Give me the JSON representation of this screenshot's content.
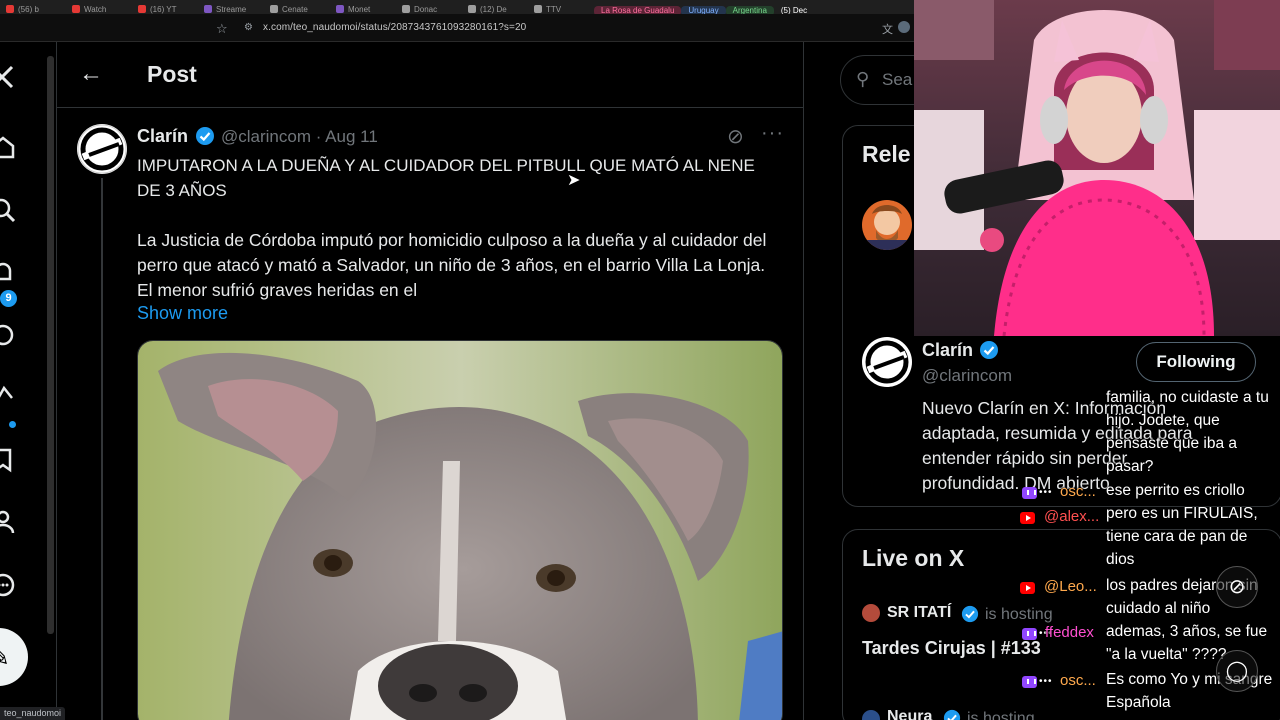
{
  "browser": {
    "tabs": [
      {
        "label": "(56) b",
        "color": "#e53935"
      },
      {
        "label": "Watch",
        "color": "#e53935"
      },
      {
        "label": "(16) YT",
        "color": "#e53935"
      },
      {
        "label": "Streame",
        "color": "#7e57c2"
      },
      {
        "label": "Cenate",
        "color": "#9e9e9e"
      },
      {
        "label": "Monet",
        "color": "#7e57c2"
      },
      {
        "label": "Donac",
        "color": "#9e9e9e"
      },
      {
        "label": "(12) De",
        "color": "#9e9e9e"
      },
      {
        "label": "TTV",
        "color": "#9e9e9e"
      }
    ],
    "group_tabs": [
      {
        "label": "La Rosa de Guadalu",
        "style": "pill-pink"
      },
      {
        "label": "Uruguay",
        "style": "pill-blue"
      },
      {
        "label": "Argentina",
        "style": "pill-green"
      },
      {
        "label": "(5) Dec",
        "style": "active"
      }
    ],
    "url": "x.com/teo_naudomoi/status/2087343761093280161?s=20",
    "status_url": "teo_naudomoi"
  },
  "nav": {
    "notification_count": "9"
  },
  "header": {
    "title": "Post"
  },
  "post": {
    "author_name": "Clarín",
    "handle_date": "@clarincom · Aug 11",
    "headline": "IMPUTARON A LA DUEÑA Y AL CUIDADOR DEL PITBULL QUE MATÓ AL NENE DE 3 AÑOS",
    "body": "La Justicia de Córdoba imputó por homicidio culposo a la dueña y al cuidador del perro que atacó y mató a Salvador, un niño de 3 años, en el barrio Villa La Lonja. El menor sufrió graves heridas en el",
    "show_more": "Show more"
  },
  "sidebar": {
    "search_placeholder": "Sea",
    "relevant_title": "Rele",
    "relevant_name": "Clarín",
    "relevant_handle": "@clarincom",
    "following_label": "Following",
    "relevant_bio": "Nuevo Clarín en X: Información adaptada, resumida y editada para entender rápido sin perder profundidad. DM abierto.",
    "live_title": "Live on X",
    "live_host": "SR ITATÍ",
    "live_hosting": "is hosting",
    "live_show": "Tardes Cirujas | #133",
    "live_host2": "Neura",
    "live_hosting2": "is hosting"
  },
  "chat": {
    "names": [
      {
        "name": "osc...",
        "platform": "tw"
      },
      {
        "name": "@alex...",
        "platform": "yt"
      },
      {
        "name": "@Leo...",
        "platform": "yt"
      },
      {
        "name": "ffeddex",
        "platform": "tw"
      },
      {
        "name": "osc...",
        "platform": "tw"
      }
    ],
    "messages": [
      "familia, no cuidaste a tu hijo. Jodete, que pensaste que iba a pasar?",
      "ese perrito es criollo pero es un FIRULAIS, tiene cara de pan de dios",
      "los padres dejaron sin cuidado al niño",
      "ademas, 3 años, se fue \"a la vuelta\" ????",
      "Es como Yo y mi sangre Española"
    ]
  },
  "colors": {
    "accent": "#1d9bf0",
    "background": "#000000",
    "text": "#e7e9ea",
    "muted": "#71767b"
  }
}
